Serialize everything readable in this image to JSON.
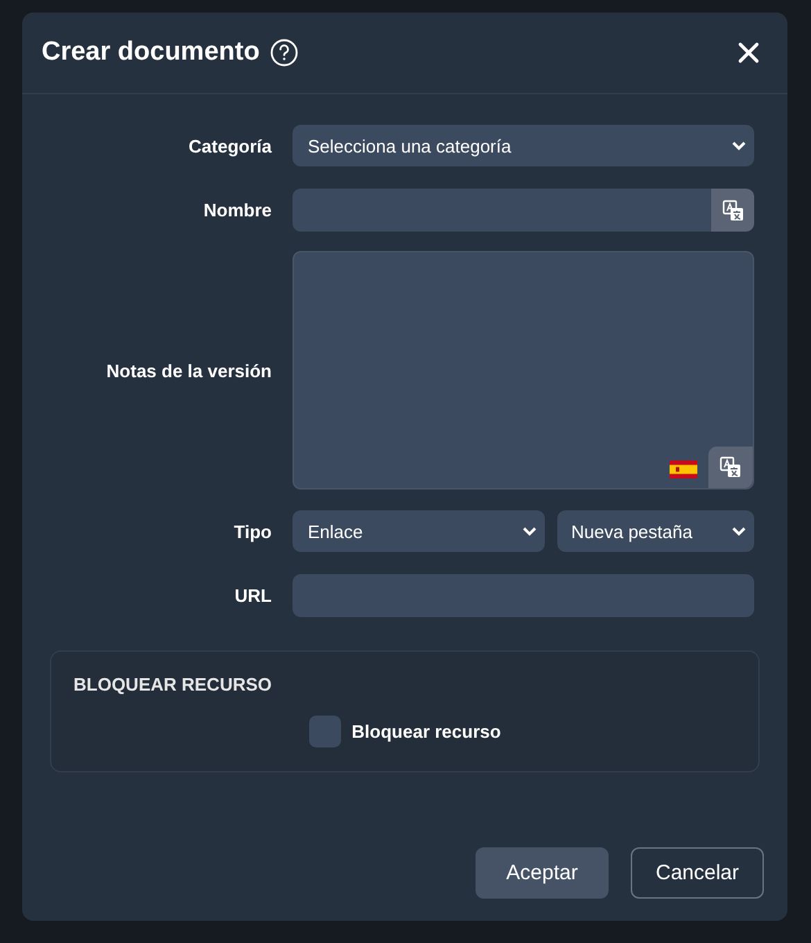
{
  "dialog": {
    "title": "Crear documento",
    "fields": [
      {
        "label": "Categoría",
        "kind": "select",
        "values": [
          "Selecciona una categoría"
        ]
      },
      {
        "label": "Nombre",
        "kind": "translatable-text"
      },
      {
        "label": "Notas de la versión",
        "kind": "translatable-textarea"
      },
      {
        "label": "Tipo",
        "kind": "select-pair",
        "values": [
          "Enlace",
          "Nueva pestaña"
        ]
      },
      {
        "label": "URL",
        "kind": "text"
      }
    ],
    "section": {
      "title": "BLOQUEAR RECURSO",
      "checkbox": {
        "label": "Bloquear recurso",
        "checked": false
      }
    },
    "buttons": [
      {
        "label": "Aceptar",
        "kind": "primary"
      },
      {
        "label": "Cancelar",
        "kind": "secondary"
      }
    ]
  }
}
